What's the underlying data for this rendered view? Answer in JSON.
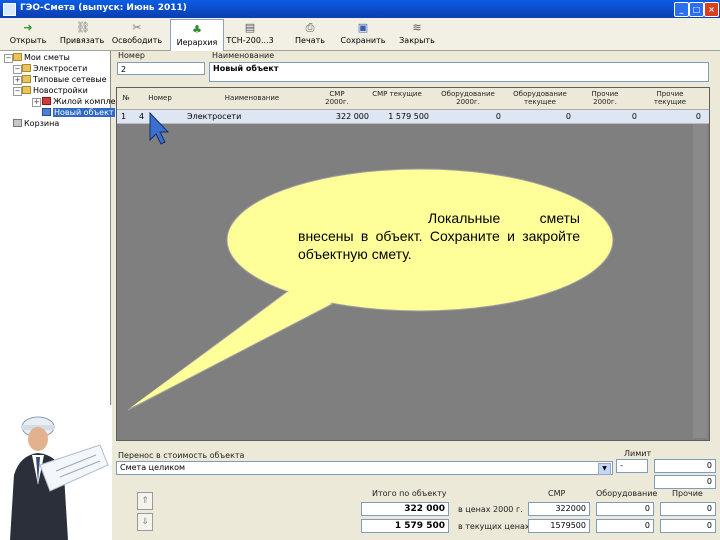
{
  "window": {
    "title": "ГЭО-Смета (выпуск: Июнь 2011)",
    "buttons": [
      "_",
      "□",
      "×"
    ]
  },
  "toolbar": {
    "items": [
      {
        "label": "Открыть",
        "icon": "arrow-right-icon"
      },
      {
        "label": "Привязать",
        "icon": "link-icon"
      },
      {
        "label": "Освободить",
        "icon": "unlink-icon"
      },
      {
        "label": "Иерархия",
        "icon": "hierarchy-icon",
        "active": true
      },
      {
        "label": "ТСН-200...3",
        "icon": "book-icon"
      },
      {
        "label": "Печать",
        "icon": "printer-icon"
      },
      {
        "label": "Сохранить",
        "icon": "save-icon"
      },
      {
        "label": "Закрыть",
        "icon": "close-icon"
      }
    ]
  },
  "tree": {
    "items": [
      {
        "label": "Мои сметы"
      },
      {
        "label": "Электросети"
      },
      {
        "label": "Типовые сетевые"
      },
      {
        "label": "Новостройки"
      },
      {
        "label": "Жилой комплекс"
      },
      {
        "label": "Новый объект",
        "selected": true
      },
      {
        "label": "Корзина"
      }
    ]
  },
  "form": {
    "number_label": "Номер",
    "number_value": "2",
    "name_label": "Наименование",
    "name_value": "Новый объект"
  },
  "grid": {
    "columns": [
      "№",
      "Номер",
      "Наименование",
      "СМР 2000г.",
      "СМР текущие",
      "Оборудование 2000г.",
      "Оборудование текущее",
      "Прочие 2000г.",
      "Прочие текущие"
    ],
    "rows": [
      [
        "1",
        "4",
        "Электросети",
        "322 000",
        "1 579 500",
        "0",
        "0",
        "0",
        "0"
      ]
    ]
  },
  "callout": {
    "text": "Локальные сметы внесены в объект. Сохраните и закройте объектную смету."
  },
  "bottom": {
    "transfer_label": "Перенос в стоимость объекта",
    "combo_value": "Смета целиком",
    "limit_label": "Лимит",
    "limit_value": "-",
    "total_label": "Итого по объекту",
    "smr_label": "СМР",
    "equip_label": "Оборудование",
    "other_label": "Прочие",
    "row_2000": {
      "total": "322 000",
      "caption": "в ценах 2000 г.",
      "smr": "322000",
      "equip": "0",
      "other": "0"
    },
    "row_current": {
      "total": "1 579 500",
      "caption": "в текущих ценах",
      "smr": "1579500",
      "equip": "0",
      "other": "0"
    },
    "side_values": [
      "0",
      "0"
    ],
    "up_arrow": "⇑",
    "down_arrow": "⇓"
  }
}
